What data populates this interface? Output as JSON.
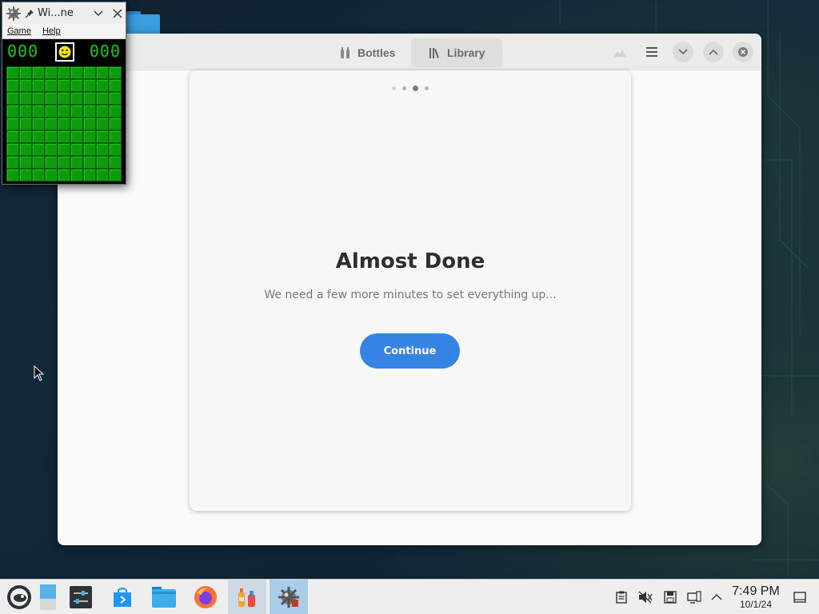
{
  "minesweeper": {
    "title": "Wi...ne",
    "menu": [
      "Game",
      "Help"
    ],
    "mines_counter": "000",
    "timer": "000",
    "grid_rows": 9,
    "grid_cols": 9
  },
  "bottles": {
    "tabs": [
      {
        "label": "Bottles",
        "icon": "bottles-icon"
      },
      {
        "label": "Library",
        "icon": "library-icon"
      }
    ],
    "dialog": {
      "page_dots": 4,
      "active_dot": 3,
      "title": "Almost Done",
      "subtitle": "We need a few more minutes to set everything up...",
      "button": "Continue"
    }
  },
  "taskbar": {
    "apps": [
      "start-menu-icon",
      "show-desktop-icon",
      "system-settings-icon",
      "discover-icon",
      "dolphin-icon",
      "firefox-icon",
      "bottles-icon",
      "winemine-icon"
    ],
    "clock": {
      "time": "7:49 PM",
      "date": "10/1/24"
    }
  },
  "colors": {
    "accent": "#3584e4",
    "lcd": "#16c916",
    "mine_cell": "#0a9c0a"
  }
}
